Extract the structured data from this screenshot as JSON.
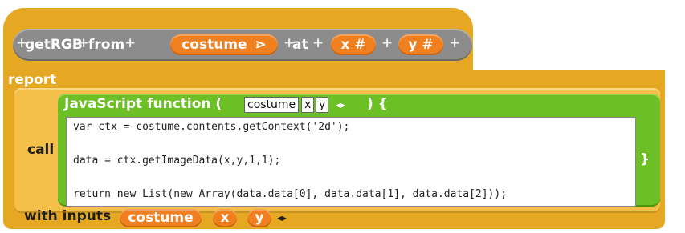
{
  "prototype": {
    "plus": "+",
    "word_get": "getRGB",
    "word_from": "from",
    "input_costume": "costume",
    "costume_arrow": "⋗",
    "word_at": "at",
    "input_x": "x #",
    "input_y": "y #"
  },
  "report_label": "report",
  "call_label": "call",
  "js": {
    "title": "JavaScript function (",
    "params": [
      "costume",
      "x",
      "y"
    ],
    "close": ") {",
    "end_brace": "}",
    "arrows": "◂▸"
  },
  "code_lines": [
    "var ctx = costume.contents.getContext('2d');",
    "",
    "data = ctx.getImageData(x,y,1,1);",
    "",
    "return new List(new Array(data.data[0], data.data[1], data.data[2]));"
  ],
  "with_inputs": {
    "label": "with inputs",
    "inputs": [
      "costume",
      "x",
      "y"
    ],
    "arrows": "◂▸"
  },
  "colors": {
    "control": "#e6a822",
    "prototype": "#8c8c8c",
    "variable": "#f07f1f",
    "operator": "#6cbf24"
  }
}
